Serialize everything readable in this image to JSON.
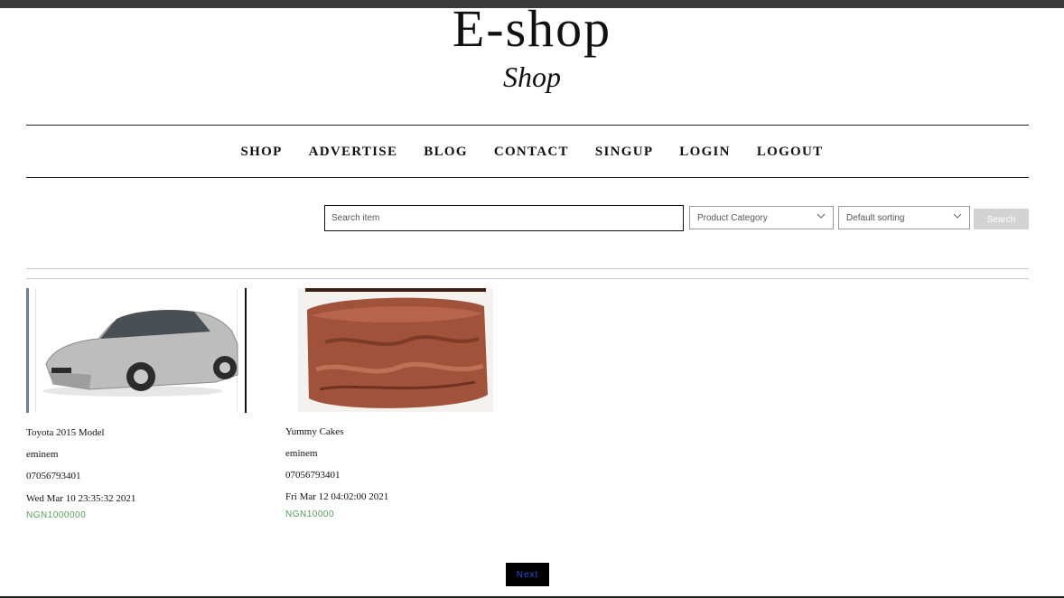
{
  "header": {
    "title": "E-shop",
    "subtitle": "Shop"
  },
  "nav": {
    "items": [
      "SHOP",
      "ADVERTISE",
      "BLOG",
      "CONTACT",
      "SINGUP",
      "LOGIN",
      "LOGOUT"
    ]
  },
  "search": {
    "placeholder": "Search item",
    "category_label": "Product Category",
    "sorting_label": "Default sorting",
    "button_label": "Search"
  },
  "products": [
    {
      "name": "Toyota 2015 Model",
      "seller": "eminem",
      "phone": "07056793401",
      "date": "Wed Mar 10 23:35:32 2021",
      "price": "NGN1000000",
      "image": "car-photo"
    },
    {
      "name": "Yummy Cakes",
      "seller": "eminem",
      "phone": "07056793401",
      "date": "Fri Mar 12 04:02:00 2021",
      "price": "NGN10000",
      "image": "cake-photo"
    }
  ],
  "pagination": {
    "next_label": "Next"
  },
  "colors": {
    "price": "#5a9a5a",
    "next_text": "#2b4fd8",
    "search_button": "#d3d3d3"
  }
}
